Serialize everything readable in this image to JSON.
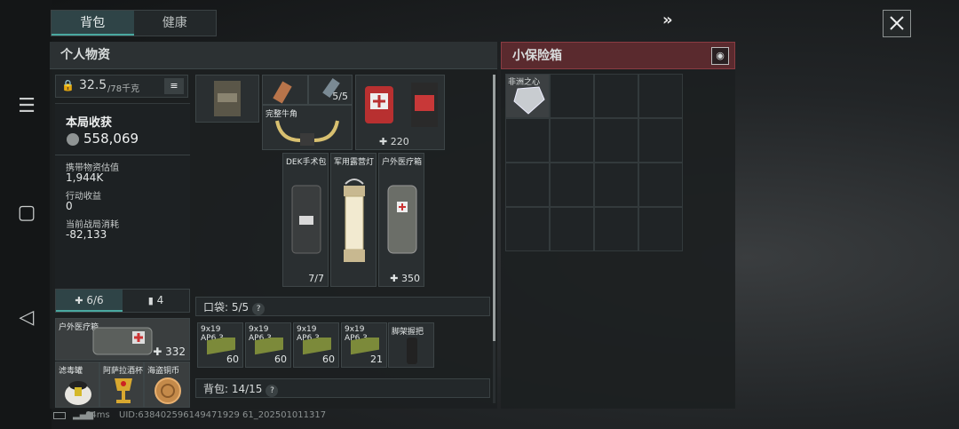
{
  "tabs": {
    "backpack": "背包",
    "health": "健康"
  },
  "personal": {
    "title": "个人物资",
    "weight": "32.5",
    "weight_max": "/78千克"
  },
  "loot": {
    "title": "本局收获",
    "amount": "558,069"
  },
  "stats": [
    {
      "label": "携带物资估值",
      "value": "1,944K"
    },
    {
      "label": "行动收益",
      "value": "0"
    },
    {
      "label": "当前战局消耗",
      "value": "-82,133"
    }
  ],
  "safe": {
    "title": "小保险箱",
    "item_name": "非洲之心"
  },
  "items": {
    "count55": "5/5",
    "horn": "完整牛角",
    "plus220": "220",
    "dek": "DEK手术包",
    "dek_ct": "7/7",
    "lamp": "军用露营灯",
    "medbox": "户外医疗箱",
    "medbox_ct": "350"
  },
  "pocket": {
    "label": "口袋: 5/5",
    "q": "?"
  },
  "ammo": [
    {
      "name": "9x19",
      "sub": "AP6.3",
      "ct": "60"
    },
    {
      "name": "9x19",
      "sub": "AP6.3",
      "ct": "60"
    },
    {
      "name": "9x19",
      "sub": "AP6.3",
      "ct": "60"
    },
    {
      "name": "9x19",
      "sub": "AP6.3",
      "ct": "21"
    }
  ],
  "grip": "脚架握把",
  "backpack": {
    "label": "背包: 14/15",
    "q": "?"
  },
  "bottom": {
    "medtab": "6/6",
    "cantab": "4",
    "medbox": "户外医疗箱",
    "medbox_ct": "332",
    "filter": "滤毒罐",
    "cup": "阿萨拉酒杯",
    "coin": "海盗铜币"
  },
  "status": {
    "ping": "64ms",
    "uid": "UID:638402596149471929 61_202501011317"
  },
  "colors": {
    "accent": "#49a8a0",
    "safe_header": "#5a2a2e"
  }
}
